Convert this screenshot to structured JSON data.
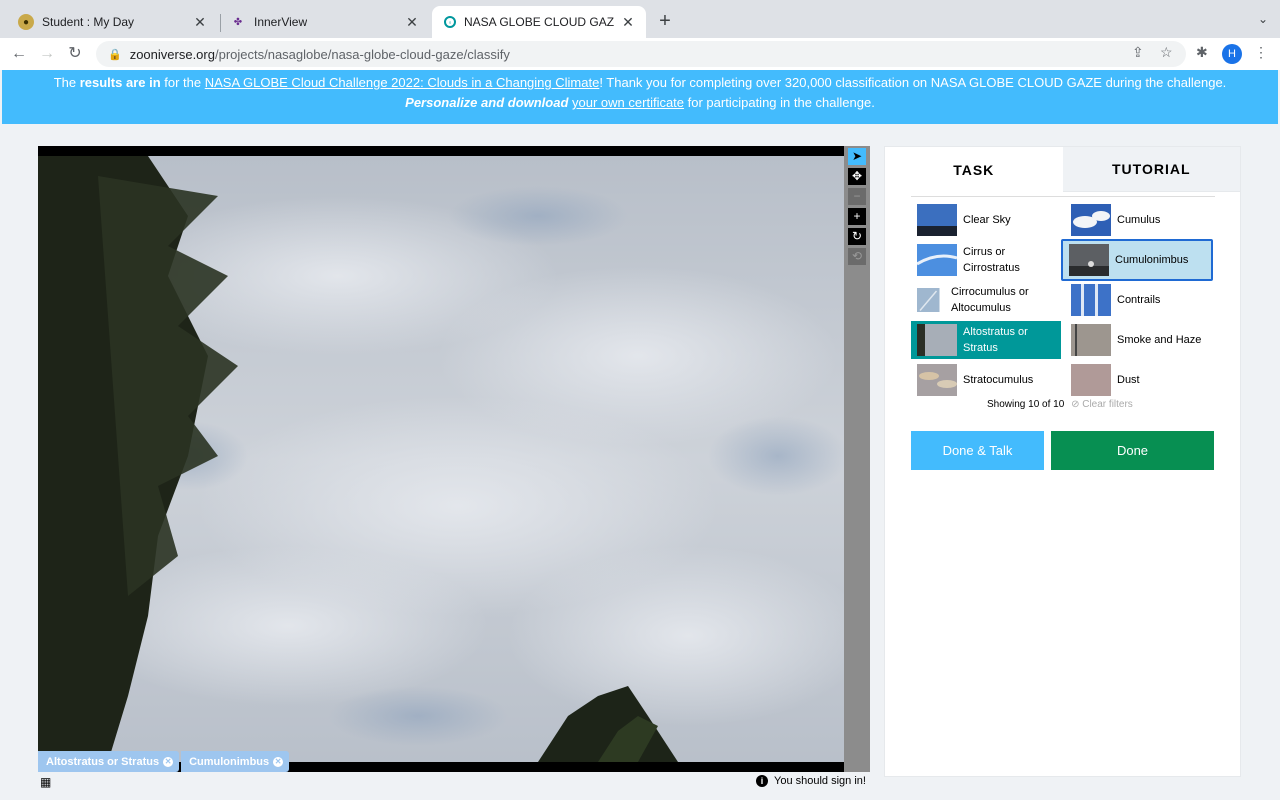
{
  "browser": {
    "tabs": [
      {
        "title": "Student : My Day"
      },
      {
        "title": "InnerView"
      },
      {
        "title": "NASA GLOBE CLOUD GAZE » "
      }
    ],
    "url_host": "zooniverse.org",
    "url_path": "/projects/nasaglobe/nasa-globe-cloud-gaze/classify",
    "profile_initial": "H"
  },
  "banner": {
    "line1_pre": "The ",
    "line1_bold": "results are in",
    "line1_mid": " for the ",
    "line1_link": "NASA GLOBE Cloud Challenge 2022: Clouds in a Changing Climate",
    "line1_post": "! Thank you for completing over 320,000 classification on NASA GLOBE CLOUD GAZE during the challenge.",
    "line2_bold": "Personalize and download",
    "line2_link": "your own certificate",
    "line2_post": " for participating in the challenge."
  },
  "viewer": {
    "marks": [
      "Altostratus or Stratus",
      "Cumulonimbus"
    ],
    "signin_text": "You should sign in!"
  },
  "panel": {
    "tab_task": "TASK",
    "tab_tutorial": "TUTORIAL",
    "choices": [
      {
        "label": "Clear Sky",
        "state": "normal"
      },
      {
        "label": "Cumulus",
        "state": "normal"
      },
      {
        "label": "Cirrus or Cirrostratus",
        "state": "normal"
      },
      {
        "label": "Cumulonimbus",
        "state": "focused"
      },
      {
        "label": "Cirrocumulus or Altocumulus",
        "state": "normal"
      },
      {
        "label": "Contrails",
        "state": "normal"
      },
      {
        "label": "Altostratus or Stratus",
        "state": "checked"
      },
      {
        "label": "Smoke and Haze",
        "state": "normal"
      },
      {
        "label": "Stratocumulus",
        "state": "normal"
      },
      {
        "label": "Dust",
        "state": "normal"
      }
    ],
    "showing": "Showing 10 of 10",
    "clear_filters": "Clear filters",
    "done_talk": "Done & Talk",
    "done": "Done"
  }
}
